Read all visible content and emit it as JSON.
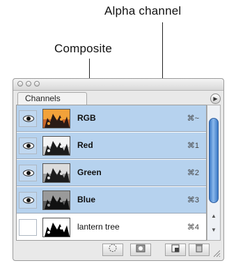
{
  "callouts": {
    "alpha": "Alpha channel",
    "composite": "Composite"
  },
  "panel": {
    "tab_label": "Channels",
    "menu_icon": "panel-menu-arrow-icon",
    "rows": [
      {
        "name": "RGB",
        "shortcut": "⌘~",
        "visible": true,
        "selected": true,
        "thumb": "color"
      },
      {
        "name": "Red",
        "shortcut": "⌘1",
        "visible": true,
        "selected": true,
        "thumb": "gray-light"
      },
      {
        "name": "Green",
        "shortcut": "⌘2",
        "visible": true,
        "selected": true,
        "thumb": "gray-mid"
      },
      {
        "name": "Blue",
        "shortcut": "⌘3",
        "visible": true,
        "selected": true,
        "thumb": "gray-dark"
      },
      {
        "name": "lantern tree",
        "shortcut": "⌘4",
        "visible": false,
        "selected": false,
        "thumb": "mask"
      }
    ],
    "bottom_icons": [
      "load-selection-icon",
      "save-selection-icon",
      "new-channel-icon",
      "trash-icon"
    ],
    "colors": {
      "selected_row": "#b6d2ee",
      "scroll_thumb": "#3b79c6"
    }
  }
}
